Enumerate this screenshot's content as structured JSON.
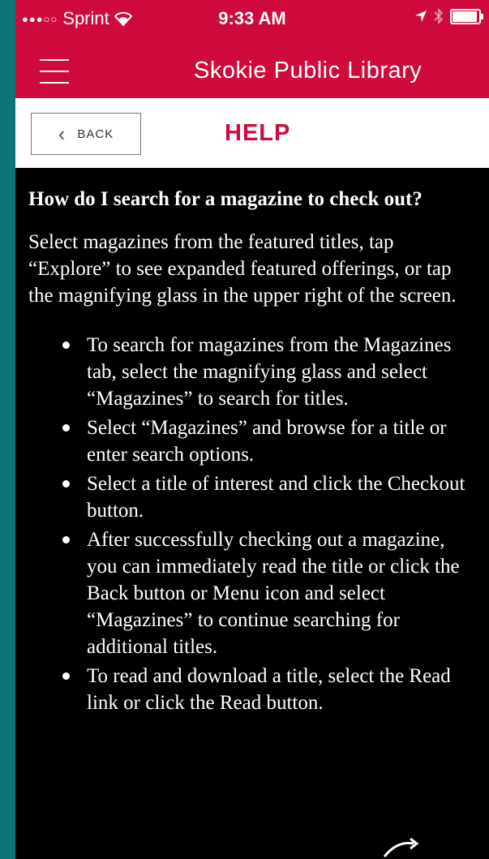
{
  "status_bar": {
    "signal": "●●●○○",
    "carrier": "Sprint",
    "time": "9:33 AM"
  },
  "nav": {
    "title": "Skokie Public Library"
  },
  "header": {
    "back_label": "BACK",
    "title": "HELP"
  },
  "content": {
    "question": "How do I search for a magazine to check out?",
    "intro": "Select magazines from the featured titles, tap “Explore” to see expanded featured offerings, or tap the magnifying glass in the upper right of the screen.",
    "bullets": [
      "To search for magazines from the Magazines tab, select the magnifying glass and select “Magazines” to search for titles.",
      "Select “Magazines” and browse for a title or enter search options.",
      "Select a title of interest and click the Checkout button.",
      "After successfully checking out a magazine, you can immediately read the title or click the Back button or Menu icon and select “Magazines” to continue searching for additional titles.",
      "To read and download a title, select the Read link or click the Read button."
    ]
  },
  "colors": {
    "brand": "#cf0a3c",
    "frame": "#0d7478",
    "content_bg": "#000000"
  }
}
